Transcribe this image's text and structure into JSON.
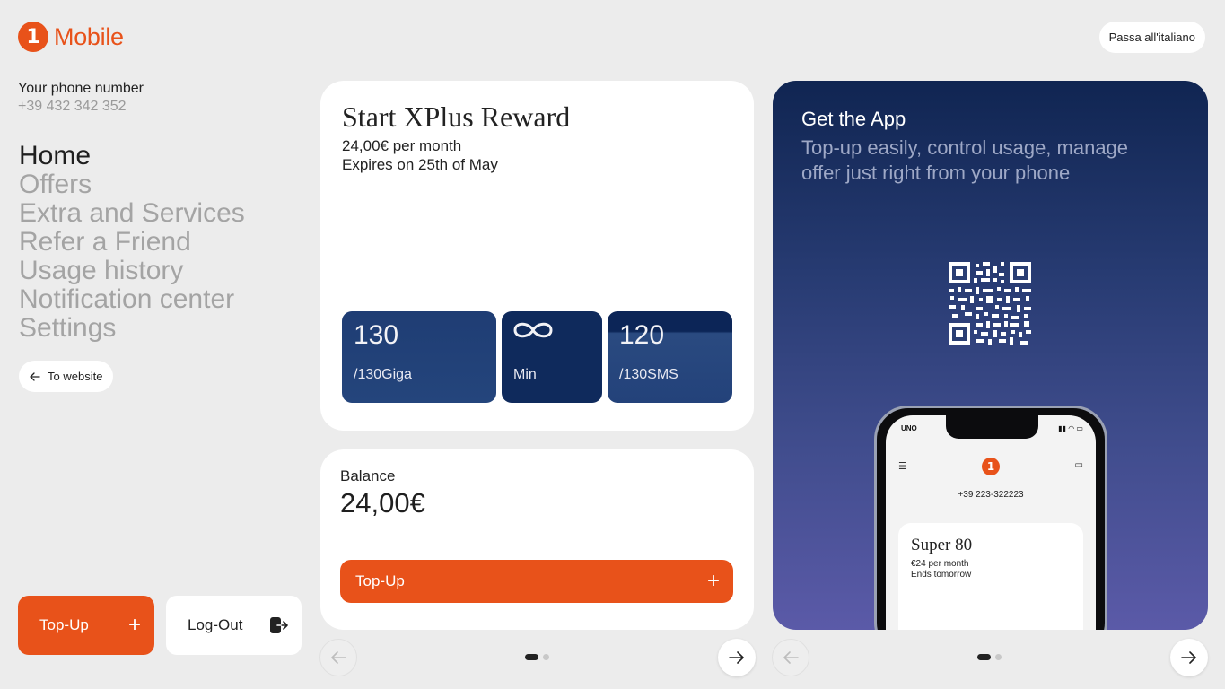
{
  "brand": {
    "logo_mark": "1",
    "name": "Mobile",
    "accent": "#e8521a"
  },
  "language_button": "Passa all'italiano",
  "account": {
    "phone_label": "Your phone number",
    "phone_number": "+39 432 342 352"
  },
  "nav": {
    "items": [
      {
        "label": "Home",
        "active": true
      },
      {
        "label": "Offers"
      },
      {
        "label": "Extra and Services"
      },
      {
        "label": "Refer a Friend"
      },
      {
        "label": "Usage history"
      },
      {
        "label": "Notification center"
      },
      {
        "label": "Settings"
      }
    ]
  },
  "to_website": {
    "icon": "arrow-left-icon",
    "label": "To website"
  },
  "sidebar_actions": {
    "topup_label": "Top-Up",
    "topup_icon": "plus-icon",
    "logout_label": "Log-Out",
    "logout_icon": "logout-icon"
  },
  "offer": {
    "title": "Start XPlus Reward",
    "price": "24,00€ per month",
    "expires": "Expires on 25th of May",
    "allowances": [
      {
        "value": "130",
        "label": "/130Giga"
      },
      {
        "value": "∞",
        "icon": "infinity-icon",
        "label": "Min"
      },
      {
        "value": "120",
        "label": "/130SMS"
      }
    ]
  },
  "balance": {
    "label": "Balance",
    "value": "24,00€",
    "topup_label": "Top-Up",
    "topup_icon": "plus-icon"
  },
  "left_carousel": {
    "page_count": 2,
    "active_index": 0,
    "prev_icon": "arrow-left-icon",
    "next_icon": "arrow-right-icon"
  },
  "app_promo": {
    "title": "Get the App",
    "subtitle": "Top-up easily, control usage, manage offer just right from your phone",
    "qr_icon": "qr-code-icon",
    "phone_mockup": {
      "carrier": "UNO",
      "number": "+39 223-322223",
      "card_title": "Super 80",
      "card_price": "€24 per month",
      "card_ends": "Ends tomorrow"
    }
  },
  "right_carousel": {
    "page_count": 2,
    "active_index": 0,
    "prev_icon": "arrow-left-icon",
    "next_icon": "arrow-right-icon"
  }
}
